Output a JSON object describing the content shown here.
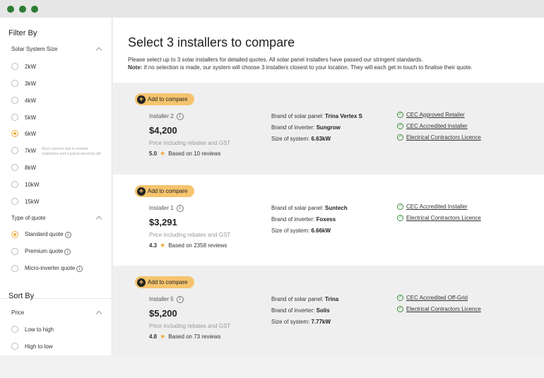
{
  "window": {
    "dot_color": "#2e7d32"
  },
  "sidebar": {
    "filter_title": "Filter By",
    "solar_size": {
      "label": "Solar System Size",
      "options": [
        "2kW",
        "3kW",
        "4kW",
        "5kW",
        "6kW",
        "7kW",
        "8kW",
        "10kW",
        "15kW"
      ],
      "selected": "6kW",
      "hint": "Most common due to network restrictions and a typical electricity bill"
    },
    "quote_type": {
      "label": "Type of quote",
      "options": [
        "Standard quote",
        "Premium quote",
        "Micro-inverter quote"
      ],
      "selected": "Standard quote",
      "info_glyph": "i"
    },
    "sort_title": "Sort By",
    "price": {
      "label": "Price",
      "options": [
        "Low to high",
        "High to low"
      ]
    }
  },
  "header": {
    "title": "Select 3 installers to compare",
    "description": "Please select up to 3 solar installers for detailed quotes. All solar panel installers have passed our stringent standards.",
    "note_label": "Note:",
    "note_text": " if no selection is made, our system will choose 3 installers closest to your location. They will each get in touch to finalise their quote."
  },
  "cards": [
    {
      "add_label": "Add to compare",
      "name": "Installer 2",
      "price": "$4,200",
      "price_note": "Price including rebates and GST",
      "rating": "5.0",
      "reviews": "Based on 10 reviews",
      "panel_label": "Brand of solar panel: ",
      "panel": "Trina Vertex S",
      "inverter_label": "Brand of inverter: ",
      "inverter": "Sungrow",
      "size_label": "Size of system: ",
      "size": "6.63kW",
      "certs": [
        "CEC Approved Retailer",
        "CEC Accredited Installer",
        "Electrical Contractors Licence"
      ]
    },
    {
      "add_label": "Add to compare",
      "name": "Installer 1",
      "price": "$3,291",
      "price_note": "Price including rebates and GST",
      "rating": "4.3",
      "reviews": "Based on 2358 reviews",
      "panel_label": "Brand of solar panel: ",
      "panel": "Suntech",
      "inverter_label": "Brand of inverter: ",
      "inverter": "Foxess",
      "size_label": "Size of system: ",
      "size": "6.66kW",
      "certs": [
        "CEC Accredited Installer",
        "Electrical Contractors Licence"
      ]
    },
    {
      "add_label": "Add to compare",
      "name": "Installer 5",
      "price": "$5,200",
      "price_note": "Price including rebates and GST",
      "rating": "4.8",
      "reviews": "Based on 73 reviews",
      "panel_label": "Brand of solar panel: ",
      "panel": "Trina",
      "inverter_label": "Brand of inverter: ",
      "inverter": "Solis",
      "size_label": "Size of system: ",
      "size": "7.77kW",
      "certs": [
        "CEC Accredited Off-Grid",
        "Electrical Contractors Licence"
      ]
    }
  ],
  "colors": {
    "accent": "#f5c46e",
    "check": "#3a8f3a",
    "star": "#f0a93a",
    "selected_radio": "#f2a93b"
  }
}
